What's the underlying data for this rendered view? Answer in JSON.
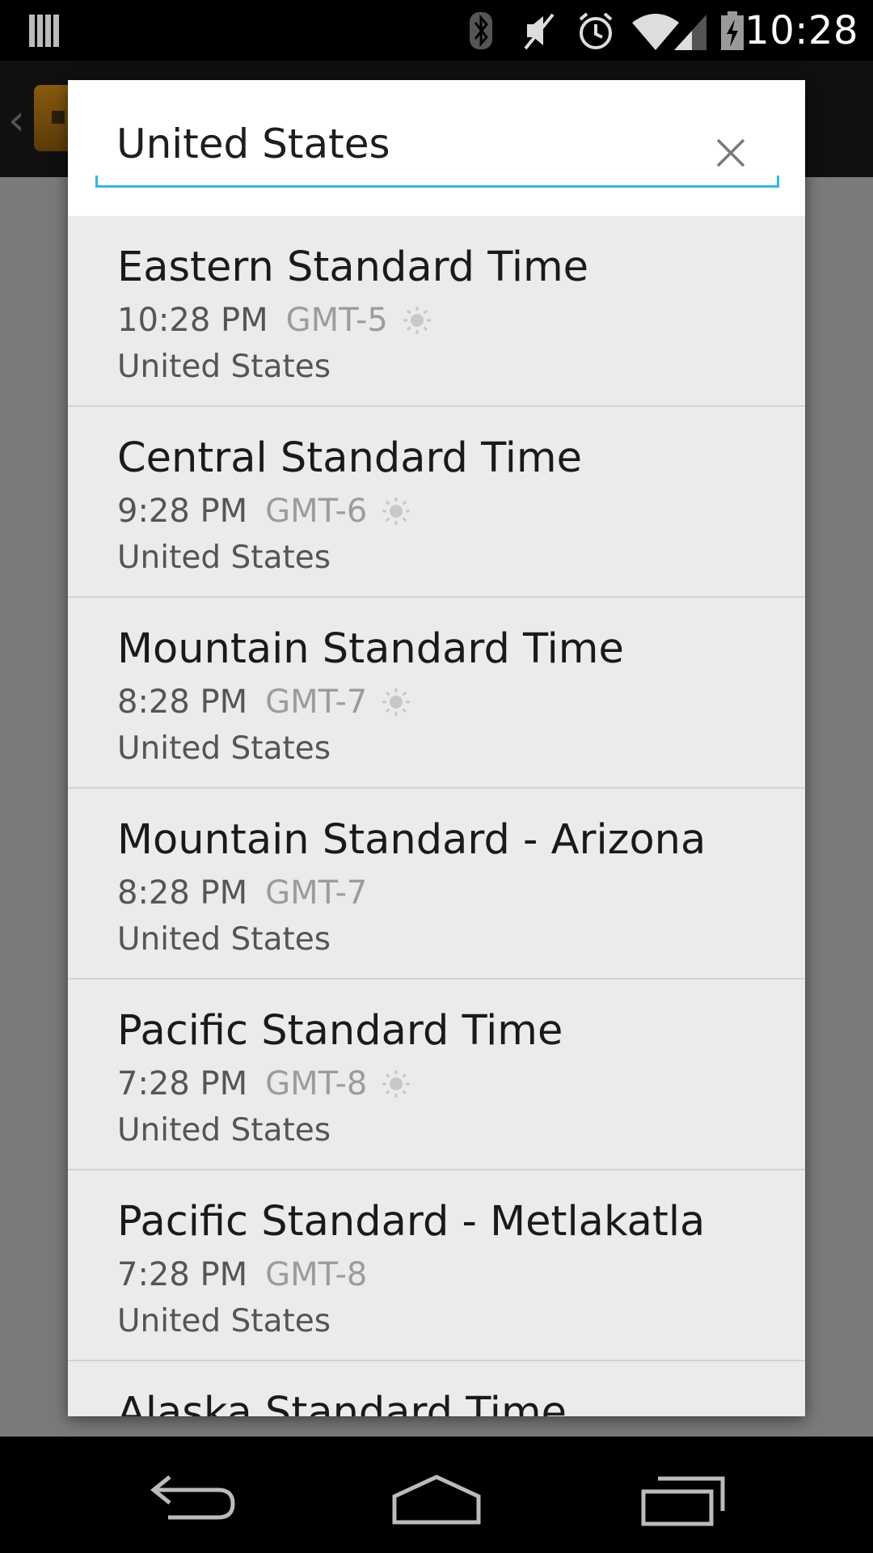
{
  "status_bar": {
    "time": "10:28",
    "icons": [
      "notification-bars-icon",
      "bluetooth-icon",
      "muted-icon",
      "alarm-icon",
      "wifi-icon",
      "signal-icon",
      "battery-charging-icon"
    ]
  },
  "dialog": {
    "search": {
      "value": "United States",
      "clear_icon": "close-icon"
    },
    "timezones": [
      {
        "name": "Eastern Standard Time",
        "time": "10:28 PM",
        "gmt": "GMT-5",
        "dst": true,
        "country": "United States"
      },
      {
        "name": "Central Standard Time",
        "time": "9:28 PM",
        "gmt": "GMT-6",
        "dst": true,
        "country": "United States"
      },
      {
        "name": "Mountain Standard Time",
        "time": "8:28 PM",
        "gmt": "GMT-7",
        "dst": true,
        "country": "United States"
      },
      {
        "name": "Mountain Standard - Arizona",
        "time": "8:28 PM",
        "gmt": "GMT-7",
        "dst": false,
        "country": "United States"
      },
      {
        "name": "Pacific Standard Time",
        "time": "7:28 PM",
        "gmt": "GMT-8",
        "dst": true,
        "country": "United States"
      },
      {
        "name": "Pacific Standard - Metlakatla",
        "time": "7:28 PM",
        "gmt": "GMT-8",
        "dst": false,
        "country": "United States"
      },
      {
        "name": "Alaska Standard Time",
        "time": "",
        "gmt": "",
        "dst": false,
        "country": ""
      }
    ]
  },
  "nav_bar": {
    "icons": [
      "back-icon",
      "home-icon",
      "recent-apps-icon"
    ]
  },
  "colors": {
    "accent": "#33b5e5",
    "dialog_bg": "#ebebeb",
    "search_bg": "#ffffff"
  }
}
